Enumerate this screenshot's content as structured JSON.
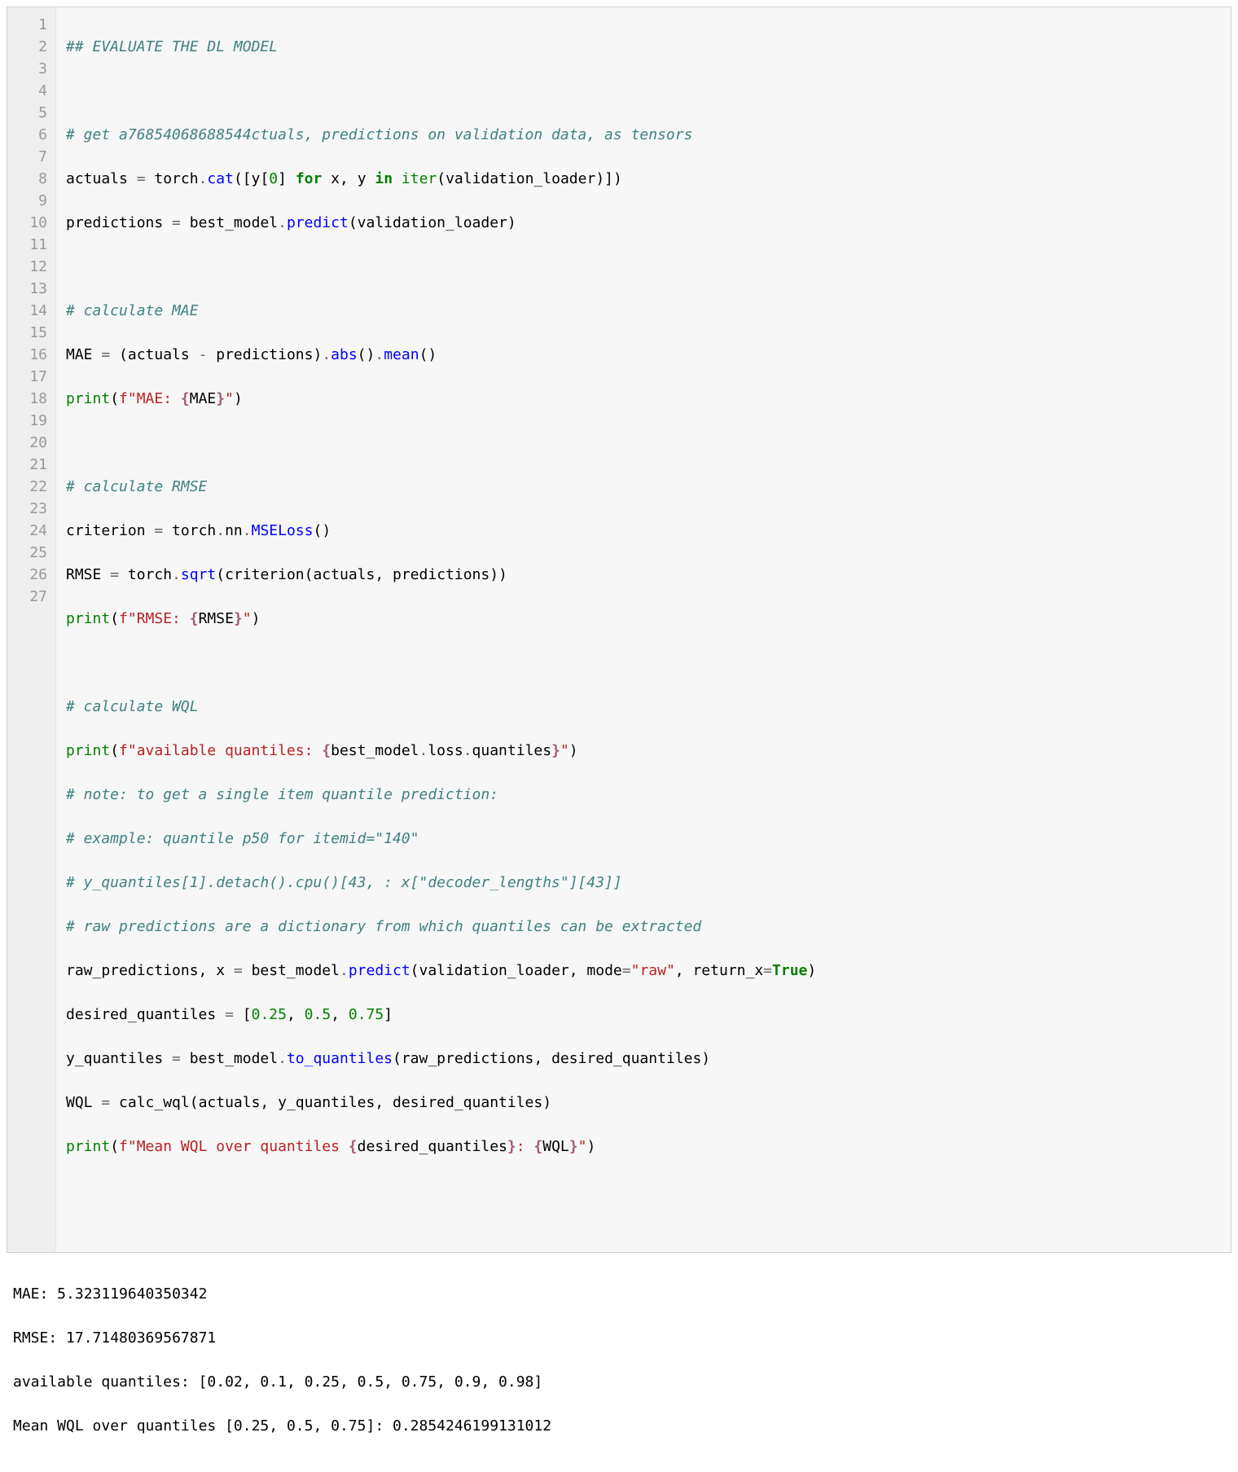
{
  "code": {
    "lines": [
      {
        "n": "1"
      },
      {
        "n": "2"
      },
      {
        "n": "3"
      },
      {
        "n": "4"
      },
      {
        "n": "5"
      },
      {
        "n": "6"
      },
      {
        "n": "7"
      },
      {
        "n": "8"
      },
      {
        "n": "9"
      },
      {
        "n": "10"
      },
      {
        "n": "11"
      },
      {
        "n": "12"
      },
      {
        "n": "13"
      },
      {
        "n": "14"
      },
      {
        "n": "15"
      },
      {
        "n": "16"
      },
      {
        "n": "17"
      },
      {
        "n": "18"
      },
      {
        "n": "19"
      },
      {
        "n": "20"
      },
      {
        "n": "21"
      },
      {
        "n": "22"
      },
      {
        "n": "23"
      },
      {
        "n": "24"
      },
      {
        "n": "25"
      },
      {
        "n": "26"
      },
      {
        "n": "27"
      }
    ],
    "tokens": {
      "l1_comment": "## EVALUATE THE DL MODEL",
      "l3_comment": "# get a76854068688544ctuals, predictions on validation data, as tensors",
      "l4_actuals": "actuals ",
      "l4_eq": "=",
      "l4_torch": " torch",
      "l4_dot1": ".",
      "l4_cat": "cat",
      "l4_open": "([y[",
      "l4_zero": "0",
      "l4_close1": "] ",
      "l4_for": "for",
      "l4_xy": " x, y ",
      "l4_in": "in",
      "l4_iter": " iter",
      "l4_tail": "(validation_loader)])",
      "l5_pred": "predictions ",
      "l5_eq": "=",
      "l5_bm": " best_model",
      "l5_dot": ".",
      "l5_predict": "predict",
      "l5_tail": "(validation_loader)",
      "l7_comment": "# calculate MAE",
      "l8_mae": "MAE ",
      "l8_eq": "=",
      "l8_open": " (actuals ",
      "l8_minus": "-",
      "l8_pred": " predictions)",
      "l8_dot1": ".",
      "l8_abs": "abs",
      "l8_paren1": "()",
      "l8_dot2": ".",
      "l8_mean": "mean",
      "l8_paren2": "()",
      "l9_print": "print",
      "l9_open": "(",
      "l9_f": "f\"MAE: ",
      "l9_interp_open": "{",
      "l9_interp_var": "MAE",
      "l9_interp_close": "}",
      "l9_strclose": "\"",
      "l9_close": ")",
      "l11_comment": "# calculate RMSE",
      "l12_crit": "criterion ",
      "l12_eq": "=",
      "l12_torch": " torch",
      "l12_dot1": ".",
      "l12_nn": "nn",
      "l12_dot2": ".",
      "l12_mse": "MSELoss",
      "l12_paren": "()",
      "l13_rmse": "RMSE ",
      "l13_eq": "=",
      "l13_torch": " torch",
      "l13_dot": ".",
      "l13_sqrt": "sqrt",
      "l13_tail": "(criterion(actuals, predictions))",
      "l14_print": "print",
      "l14_open": "(",
      "l14_f": "f\"RMSE: ",
      "l14_interp_open": "{",
      "l14_interp_var": "RMSE",
      "l14_interp_close": "}",
      "l14_strclose": "\"",
      "l14_close": ")",
      "l16_comment": "# calculate WQL",
      "l17_print": "print",
      "l17_open": "(",
      "l17_f": "f\"available quantiles: ",
      "l17_interp_open": "{",
      "l17_interp_bm": "best_model",
      "l17_dot1": ".",
      "l17_loss": "loss",
      "l17_dot2": ".",
      "l17_quant": "quantiles",
      "l17_interp_close": "}",
      "l17_strclose": "\"",
      "l17_close": ")",
      "l18_comment": "# note: to get a single item quantile prediction:",
      "l19_comment": "# example: quantile p50 for itemid=\"140\"",
      "l20_comment": "# y_quantiles[1].detach().cpu()[43, : x[\"decoder_lengths\"][43]]",
      "l21_comment": "# raw predictions are a dictionary from which quantiles can be extracted",
      "l22_raw": "raw_predictions, x ",
      "l22_eq": "=",
      "l22_bm": " best_model",
      "l22_dot": ".",
      "l22_predict": "predict",
      "l22_open": "(validation_loader, mode",
      "l22_eq2": "=",
      "l22_raw_str": "\"raw\"",
      "l22_retx": ", return_x",
      "l22_eq3": "=",
      "l22_true": "True",
      "l22_close": ")",
      "l23_dq": "desired_quantiles ",
      "l23_eq": "=",
      "l23_open": " [",
      "l23_v1": "0.25",
      "l23_c1": ", ",
      "l23_v2": "0.5",
      "l23_c2": ", ",
      "l23_v3": "0.75",
      "l23_close": "]",
      "l24_yq": "y_quantiles ",
      "l24_eq": "=",
      "l24_bm": " best_model",
      "l24_dot": ".",
      "l24_toq": "to_quantiles",
      "l24_tail": "(raw_predictions, desired_quantiles)",
      "l25_wql": "WQL ",
      "l25_eq": "=",
      "l25_tail": " calc_wql(actuals, y_quantiles, desired_quantiles)",
      "l26_print": "print",
      "l26_open": "(",
      "l26_f": "f\"Mean WQL over quantiles ",
      "l26_i1o": "{",
      "l26_i1v": "desired_quantiles",
      "l26_i1c": "}",
      "l26_mid": ": ",
      "l26_i2o": "{",
      "l26_i2v": "WQL",
      "l26_i2c": "}",
      "l26_strclose": "\"",
      "l26_close": ")"
    }
  },
  "output": {
    "line1": "MAE: 5.323119640350342",
    "line2": "RMSE: 17.71480369567871",
    "line3": "available quantiles: [0.02, 0.1, 0.25, 0.5, 0.75, 0.9, 0.98]",
    "line4": "Mean WQL over quantiles [0.25, 0.5, 0.75]: 0.2854246199131012"
  }
}
